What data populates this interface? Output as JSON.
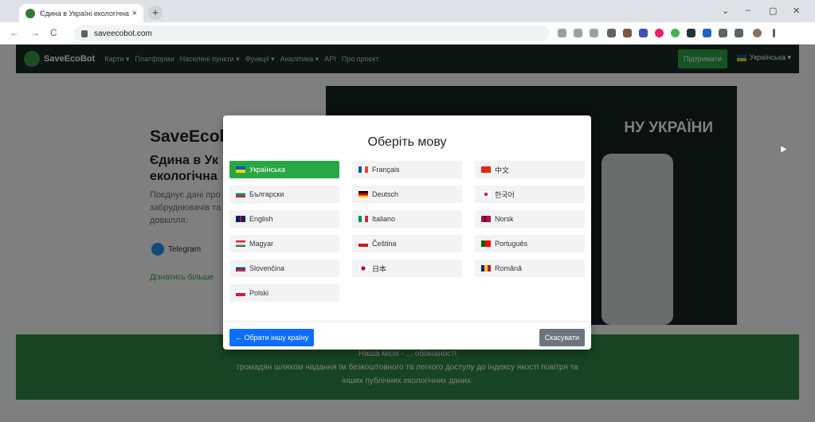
{
  "browser": {
    "tab_title": "Єдина в Україні екологічна си",
    "tab_close": "×",
    "new_tab": "+",
    "url": "saveecobot.com",
    "nav_back": "←",
    "nav_forward": "→",
    "nav_reload": "C",
    "win_min": "–",
    "win_max": "▢",
    "win_close": "✕",
    "win_dropdown": "⌄"
  },
  "site": {
    "brand": "SaveEcoBot",
    "nav": [
      "Карти ▾",
      "Платформи",
      "Населені пункти ▾",
      "Функції ▾",
      "Аналітика ▾",
      "API",
      "Про проєкт"
    ],
    "support_label": "Підтримати",
    "language_label": "Українська ▾"
  },
  "hero": {
    "title": "SaveEcol",
    "subtitle_1": "Єдина в Ук",
    "subtitle_2": "екологічна",
    "paragraph": "Поєднує дані про забруднювачів та довкілля.",
    "telegram_label": "Telegram",
    "more_link": "Дізнатись більше",
    "map_heading": "НУ УКРАЇНИ"
  },
  "mission": {
    "line_1": "Наша місія - ... обізнаності",
    "line_2": "громадян шляхом надання їм безкоштовного та легкого доступу до індексу якості повітря та",
    "line_3": "інших публічних екологічних даних."
  },
  "modal": {
    "title": "Оберіть мову",
    "languages": [
      {
        "label": "Українська",
        "active": true,
        "flag": "ua"
      },
      {
        "label": "Français",
        "active": false,
        "flag": "fr"
      },
      {
        "label": "中文",
        "active": false,
        "flag": "cn"
      },
      {
        "label": "Български",
        "active": false,
        "flag": "bg"
      },
      {
        "label": "Deutsch",
        "active": false,
        "flag": "de"
      },
      {
        "label": "한국어",
        "active": false,
        "flag": "kr"
      },
      {
        "label": "English",
        "active": false,
        "flag": "gb"
      },
      {
        "label": "Italiano",
        "active": false,
        "flag": "it"
      },
      {
        "label": "Norsk",
        "active": false,
        "flag": "no"
      },
      {
        "label": "Magyar",
        "active": false,
        "flag": "hu"
      },
      {
        "label": "Čeština",
        "active": false,
        "flag": "cz"
      },
      {
        "label": "Português",
        "active": false,
        "flag": "pt"
      },
      {
        "label": "Slovenčina",
        "active": false,
        "flag": "sk"
      },
      {
        "label": "日本",
        "active": false,
        "flag": "jp"
      },
      {
        "label": "Română",
        "active": false,
        "flag": "ro"
      },
      {
        "label": "Polski",
        "active": false,
        "flag": "pl"
      }
    ],
    "choose_country": "← Обрати іншу країну",
    "cancel": "Скасувати"
  },
  "colors": {
    "accent_green": "#28a745",
    "primary_blue": "#0d6efd",
    "secondary_gray": "#6c757d"
  }
}
